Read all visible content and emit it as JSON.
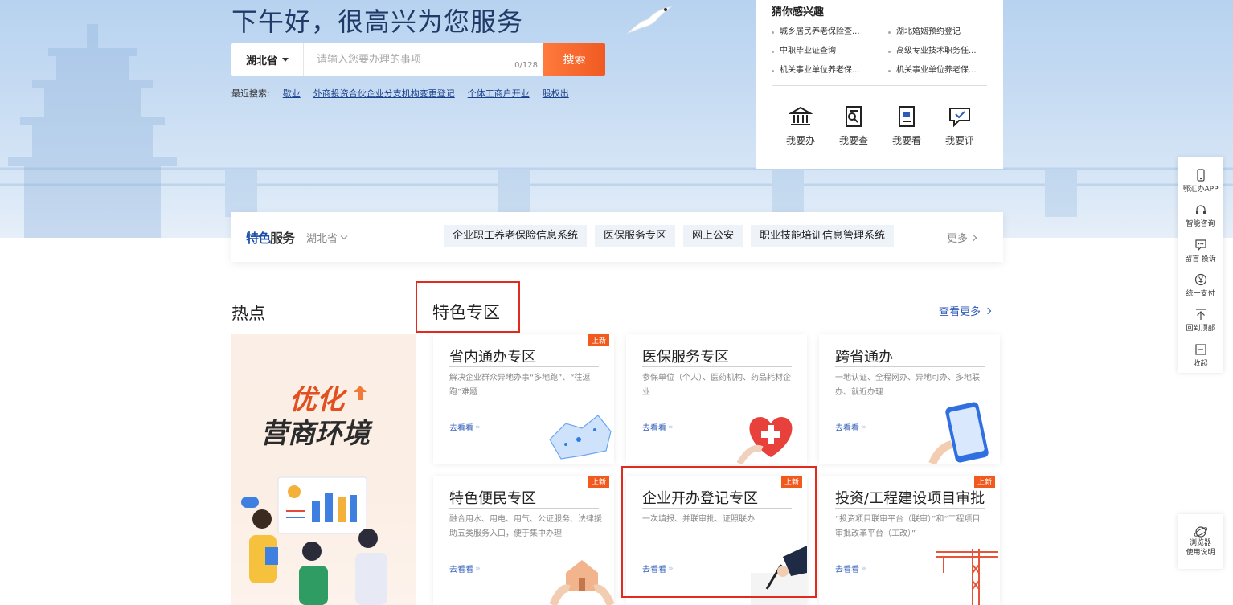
{
  "hero": {
    "greeting": "下午好，很高兴为您服务",
    "search": {
      "region": "湖北省",
      "placeholder": "请输入您要办理的事项",
      "count": "0/128",
      "button": "搜索"
    },
    "recent": {
      "label": "最近搜索:",
      "items": [
        "歇业",
        "外商投资合伙企业分支机构变更登记",
        "个体工商户开业",
        "股权出"
      ]
    }
  },
  "interest": {
    "title": "猜你感兴趣",
    "items": [
      "城乡居民养老保险查...",
      "湖北婚姻预约登记",
      "中职毕业证查询",
      "高级专业技术职务任...",
      "机关事业单位养老保...",
      "机关事业单位养老保..."
    ],
    "quick": [
      {
        "label": "我要办",
        "icon": "bank-icon"
      },
      {
        "label": "我要查",
        "icon": "search-doc-icon"
      },
      {
        "label": "我要看",
        "icon": "document-icon"
      },
      {
        "label": "我要评",
        "icon": "comment-icon"
      }
    ]
  },
  "side": {
    "items": [
      "鄂汇办APP",
      "智能咨询",
      "留言 投诉",
      "统一支付",
      "回到顶部",
      "收起"
    ],
    "guide": [
      "浏览器",
      "使用说明"
    ]
  },
  "feature_bar": {
    "logo_a": "特色",
    "logo_b": "服务",
    "region": "湖北省",
    "tags": [
      "企业职工养老保险信息系统",
      "医保服务专区",
      "网上公安",
      "职业技能培训信息管理系统"
    ],
    "more": "更多"
  },
  "sections": {
    "hot": "热点",
    "zone": "特色专区",
    "see_more": "查看更多"
  },
  "banner": {
    "line1": "优化",
    "line2": "营商环境"
  },
  "cards": [
    {
      "title": "省内通办专区",
      "desc": "解决企业群众异地办事“多地跑”、“往返跑”难题",
      "go": "去看看",
      "badge": "上新"
    },
    {
      "title": "医保服务专区",
      "desc": "参保单位（个人）、医药机构、药品耗材企业",
      "go": "去看看",
      "badge": ""
    },
    {
      "title": "跨省通办",
      "desc": "一地认证、全程网办、异地可办、多地联办、就近办理",
      "go": "去看看",
      "badge": ""
    },
    {
      "title": "特色便民专区",
      "desc": "融合用水、用电、用气、公证服务、法律援助五类服务入口，便于集中办理",
      "go": "去看看",
      "badge": "上新"
    },
    {
      "title": "企业开办登记专区",
      "desc": "一次填报、并联审批、证照联办",
      "go": "去看看",
      "badge": "上新"
    },
    {
      "title": "投资/工程建设项目审批",
      "desc": "“投资项目联审平台（联审）”和“工程项目审批改革平台（工改）”",
      "go": "去看看",
      "badge": "上新"
    }
  ],
  "colors": {
    "accent": "#2e5bb8",
    "search_button": "#f05a22",
    "highlight": "#e12b1f",
    "badge": "#f25a1d"
  }
}
